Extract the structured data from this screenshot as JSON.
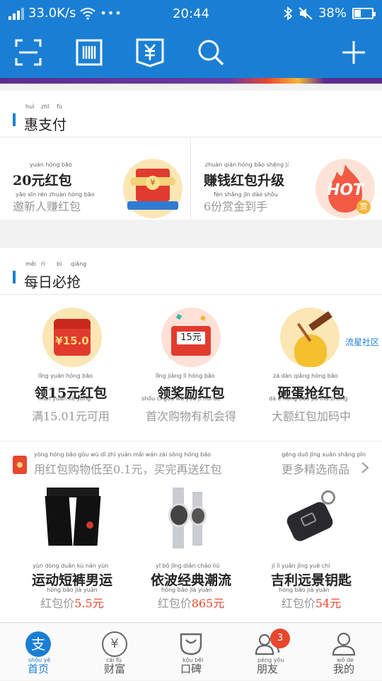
{
  "status_bar": {
    "network_speed": "33.0K/s",
    "time": "20:44",
    "battery": "38%",
    "battery_level": 0.38
  },
  "colors": {
    "brand_blue": "#1a7fd4",
    "accent_red": "#e8462f"
  },
  "toolbar": {
    "icons": [
      "scan-icon",
      "barcode-pay-icon",
      "wallet-yuan-icon",
      "search-icon",
      "plus-icon"
    ]
  },
  "hui_pay": {
    "pinyin": [
      "huì",
      "zhī",
      "fù"
    ],
    "title": "惠支付",
    "left": {
      "title_pinyin": "yuán hóng bāo",
      "title": "20元红包",
      "sub_pinyin": "yāo xīn rén zhuàn hóng bāo",
      "subtitle": "邀新人赚红包"
    },
    "right": {
      "title_pinyin": "zhuàn qián hóng bāo shēng jí",
      "title": "赚钱红包升级",
      "sub_pinyin": "fèn shǎng jīn dào shǒu",
      "subtitle": "6份赏金到手",
      "badge_text": "HOT",
      "badge_small": "赏"
    }
  },
  "daily": {
    "pinyin": [
      "měi",
      "rì",
      "bì",
      "qiǎng"
    ],
    "title": "每日必抢",
    "side_tag": "流星社区",
    "items": [
      {
        "name_pinyin": "lǐng yuán hóng bāo",
        "name": "领15元红包",
        "desc_pinyin": "mǎn yuán kě yòng",
        "desc": "满15.01元可用",
        "img_text": "¥15.0"
      },
      {
        "name_pinyin": "lǐng jiǎng lì hóng bāo",
        "name": "领奖励红包",
        "desc_pinyin": "shǒu cì gòu wù yǒu jī huì dé",
        "desc": "首次购物有机会得",
        "img_text": "15元"
      },
      {
        "name_pinyin": "zá dàn qiǎng hóng bāo",
        "name": "砸蛋抢红包",
        "desc_pinyin": "dà é hóng bāo jiā mǎ zhōng",
        "desc": "大额红包加码中",
        "img_text": ""
      }
    ]
  },
  "promo": {
    "pinyin": "yòng hóng bāo gòu wù dī zhì yuán mǎi wán zài sòng hóng bāo",
    "text": "用红包购物低至0.1元，买完再送红包",
    "more_pinyin": "gēng duō jīng xuǎn shāng pǐn",
    "more": "更多精选商品"
  },
  "products": [
    {
      "name_pinyin": "yùn dòng duǎn kù nán yùn",
      "name": "运动短裤男运",
      "price_pinyin": "hóng bāo jià yuán",
      "price_label": "红包价",
      "price": "5.5元"
    },
    {
      "name_pinyin": "yī bō jīng diǎn cháo liú",
      "name": "依波经典潮流",
      "price_pinyin": "hóng bāo jià yuán",
      "price_label": "红包价",
      "price": "865元"
    },
    {
      "name_pinyin": "jí lì yuǎn jǐng yuè chí",
      "name": "吉利远景钥匙",
      "price_pinyin": "hóng bāo jià yuán",
      "price_label": "红包价",
      "price": "54元"
    }
  ],
  "tabs": [
    {
      "pinyin": "shǒu yè",
      "label": "首页",
      "icon": "alipay-home-icon",
      "active": true
    },
    {
      "pinyin": "cái fù",
      "label": "财富",
      "icon": "wealth-yuan-icon"
    },
    {
      "pinyin": "kǒu bēi",
      "label": "口碑",
      "icon": "koubei-bag-icon"
    },
    {
      "pinyin": "péng yǒu",
      "label": "朋友",
      "icon": "friends-icon",
      "badge": "3"
    },
    {
      "pinyin": "wǒ de",
      "label": "我的",
      "icon": "profile-icon"
    }
  ]
}
